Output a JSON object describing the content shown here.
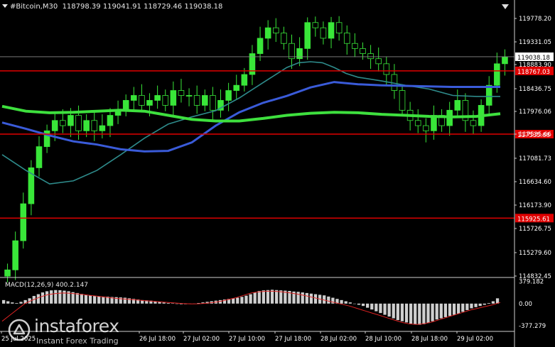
{
  "header": {
    "symbol": "#Bitcoin,M30",
    "ohlc": "118798.39 119041.91 118729.46 119038.18"
  },
  "macd_label": "MACD(12,26,9) 400.2.147",
  "logo": {
    "name": "instaforex",
    "tagline": "Instant Forex Trading"
  },
  "colors": {
    "background": "#000000",
    "candle": "#39e639",
    "ma_fast": "#2e8b8b",
    "ma_mid": "#3a5bd9",
    "ma_slow": "#3ee03e",
    "level": "#e00000",
    "macd_hist": "#cfcfcf",
    "macd_signal": "#dd2222",
    "axis_text": "#ffffff"
  },
  "chart_data": [
    {
      "type": "candlestick",
      "instrument": "#Bitcoin",
      "timeframe": "M30",
      "ylim": [
        114832.45,
        120300
      ],
      "y_ticks": [
        119778.2,
        119331.05,
        118883.9,
        118436.75,
        117976.06,
        117535.66,
        117081.73,
        116634.6,
        116173.9,
        115726.75,
        115279.6,
        114832.45
      ],
      "y_tick_labels": [
        "119778.20",
        "119331.05",
        "118883.90",
        "118436.75",
        "117976.06",
        "117535.66",
        "117081.73",
        "116634.60",
        "116173.90",
        "115726.75",
        "115279.60",
        "114832.45"
      ],
      "x_tick_labels": [
        "25 Jul 2025",
        "26 Jul 18:00",
        "27 Jul 02:00",
        "27 Jul 10:00",
        "27 Jul 18:00",
        "28 Jul 02:00",
        "28 Jul 10:00",
        "28 Jul 18:00",
        "29 Jul 02:00"
      ],
      "current_price": 119038.18,
      "current_price_label": "119038.18",
      "levels": [
        {
          "value": 118767.03,
          "label": "118767.03"
        },
        {
          "value": 117535.66,
          "label": "117535.66"
        },
        {
          "value": 115925.61,
          "label": "115925.61"
        }
      ],
      "series": [
        {
          "kind": "ma",
          "key": "ma_fast",
          "x": [
            0,
            10,
            20,
            30,
            40,
            50,
            60,
            70,
            80,
            90,
            100,
            110,
            120,
            125,
            130,
            135,
            140,
            145,
            150,
            160,
            170,
            180,
            190,
            200,
            210
          ],
          "y": [
            117150,
            116850,
            116590,
            116650,
            116850,
            117150,
            117460,
            117730,
            117870,
            117990,
            118250,
            118550,
            118830,
            118920,
            118940,
            118920,
            118830,
            118720,
            118650,
            118580,
            118500,
            118430,
            118300,
            118280,
            118280
          ]
        },
        {
          "kind": "ma",
          "key": "ma_mid",
          "x": [
            0,
            10,
            20,
            30,
            40,
            50,
            60,
            70,
            80,
            90,
            100,
            110,
            120,
            130,
            140,
            150,
            160,
            170,
            180,
            190,
            200,
            210
          ],
          "y": [
            117760,
            117640,
            117510,
            117400,
            117340,
            117250,
            117210,
            117220,
            117380,
            117700,
            117960,
            118150,
            118290,
            118460,
            118560,
            118520,
            118500,
            118490,
            118480,
            118470,
            118470,
            118470
          ]
        },
        {
          "kind": "ma",
          "key": "ma_slow",
          "x": [
            0,
            10,
            20,
            30,
            40,
            50,
            60,
            70,
            80,
            90,
            100,
            110,
            120,
            130,
            140,
            150,
            160,
            170,
            180,
            190,
            200,
            210
          ],
          "y": [
            118080,
            117980,
            117950,
            117960,
            117980,
            118000,
            117980,
            117900,
            117820,
            117790,
            117790,
            117840,
            117900,
            117940,
            117960,
            117950,
            117920,
            117900,
            117880,
            117870,
            117880,
            117930
          ]
        }
      ],
      "candle_closes": [
        114950,
        115500,
        116200,
        116900,
        117300,
        117600,
        117800,
        117700,
        117900,
        117600,
        117800,
        117600,
        117700,
        117900,
        118000,
        118200,
        118300,
        118100,
        118200,
        118300,
        118100,
        118400,
        118300,
        118300,
        118100,
        118300,
        118000,
        118200,
        118400,
        118500,
        118700,
        119100,
        119400,
        119600,
        119500,
        119300,
        119000,
        119200,
        119700,
        119600,
        119400,
        119700,
        119500,
        119300,
        119200,
        119100,
        119000,
        118900,
        118700,
        118400,
        118000,
        117800,
        117700,
        117600,
        117900,
        117700,
        118000,
        118200,
        117800,
        117700,
        118100,
        118500,
        118900,
        119038
      ]
    },
    {
      "type": "bar",
      "name": "MACD",
      "ylim": [
        -460,
        420
      ],
      "y_ticks": [
        379.182,
        0,
        -377.279
      ],
      "y_tick_labels": [
        "379.182",
        "0.00",
        "-377.279"
      ],
      "histogram": [
        60,
        40,
        20,
        10,
        30,
        60,
        90,
        130,
        160,
        190,
        210,
        225,
        230,
        228,
        220,
        210,
        195,
        180,
        165,
        150,
        140,
        130,
        125,
        120,
        118,
        112,
        110,
        105,
        100,
        90,
        80,
        70,
        60,
        55,
        50,
        40,
        30,
        20,
        10,
        5,
        0,
        -10,
        -10,
        -5,
        0,
        10,
        20,
        30,
        40,
        50,
        60,
        70,
        80,
        90,
        100,
        115,
        135,
        160,
        190,
        215,
        225,
        230,
        235,
        230,
        225,
        220,
        215,
        205,
        200,
        190,
        180,
        170,
        160,
        150,
        140,
        120,
        100,
        80,
        60,
        40,
        20,
        0,
        -20,
        -40,
        -70,
        -100,
        -130,
        -160,
        -190,
        -220,
        -250,
        -280,
        -300,
        -320,
        -340,
        -350,
        -360,
        -350,
        -330,
        -300,
        -270,
        -250,
        -230,
        -210,
        -190,
        -170,
        -140,
        -110,
        -80,
        -60,
        -40,
        -20,
        10,
        40,
        90
      ],
      "signal": [
        -300,
        -200,
        -100,
        0,
        60,
        110,
        150,
        170,
        180,
        175,
        165,
        150,
        135,
        120,
        105,
        90,
        80,
        70,
        60,
        50,
        40,
        30,
        20,
        10,
        0,
        -5,
        -3,
        5,
        20,
        40,
        70,
        100,
        140,
        180,
        200,
        210,
        210,
        200,
        185,
        165,
        140,
        110,
        80,
        50,
        20,
        -10,
        -40,
        -80,
        -120,
        -160,
        -200,
        -240,
        -280,
        -320,
        -345,
        -355,
        -340,
        -310,
        -270,
        -230,
        -190,
        -150,
        -110,
        -80,
        -50,
        -20,
        20
      ]
    }
  ]
}
